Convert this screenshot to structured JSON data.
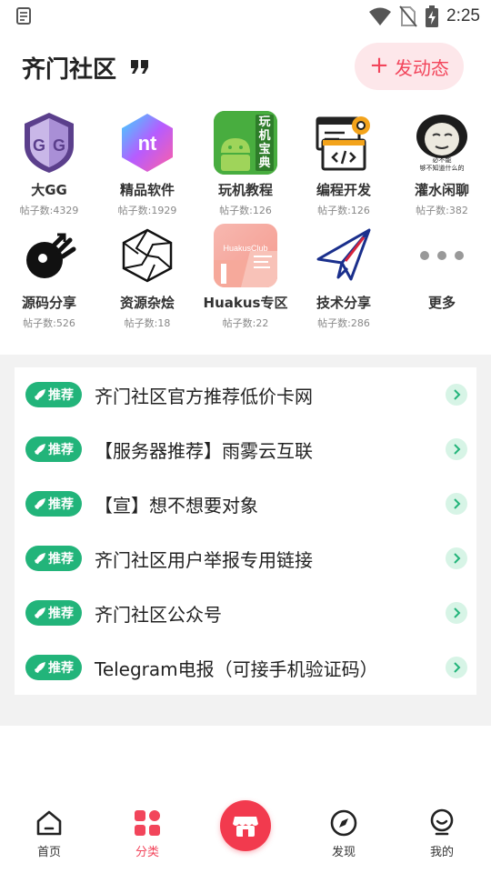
{
  "status_bar": {
    "time": "2:25",
    "icons": [
      "notes-icon",
      "wifi-icon",
      "no-sim-icon",
      "battery-charging-icon"
    ]
  },
  "header": {
    "title": "齐门社区",
    "post_button_label": "发动态",
    "accent_color": "#f2455b"
  },
  "categories": [
    {
      "label": "大GG",
      "count": "帖子数:4329",
      "icon": "gg-shield-icon"
    },
    {
      "label": "精品软件",
      "count": "帖子数:1929",
      "icon": "nt-hexagon-icon"
    },
    {
      "label": "玩机教程",
      "count": "帖子数:126",
      "icon": "android-icon",
      "icon_text": [
        "玩",
        "机",
        "宝",
        "典"
      ]
    },
    {
      "label": "编程开发",
      "count": "帖子数:126",
      "icon": "code-window-icon"
    },
    {
      "label": "灌水闲聊",
      "count": "帖子数:382",
      "icon": "meme-face-icon",
      "icon_text": [
        "必不能",
        "够不知道什么的"
      ]
    },
    {
      "label": "源码分享",
      "count": "帖子数:526",
      "icon": "source-share-icon"
    },
    {
      "label": "资源杂烩",
      "count": "帖子数:18",
      "icon": "hexagon-cube-icon"
    },
    {
      "label": "Huakus专区",
      "count": "帖子数:22",
      "icon": "huakus-club-icon",
      "icon_text": "HuakusClub"
    },
    {
      "label": "技术分享",
      "count": "帖子数:286",
      "icon": "paper-plane-icon"
    },
    {
      "label": "更多",
      "count": "",
      "icon": "more-dots-icon"
    }
  ],
  "recommend": {
    "badge_label": "推荐",
    "badge_color": "#22b47a",
    "items": [
      {
        "title": "齐门社区官方推荐低价卡网"
      },
      {
        "title": "【服务器推荐】雨雾云互联"
      },
      {
        "title": "【宣】想不想要对象"
      },
      {
        "title": "齐门社区用户举报专用链接"
      },
      {
        "title": "齐门社区公众号"
      },
      {
        "title": "Telegram电报（可接手机验证码）"
      }
    ]
  },
  "bottom_nav": {
    "items": [
      {
        "label": "首页",
        "icon": "home-icon",
        "active": false
      },
      {
        "label": "分类",
        "icon": "category-grid-icon",
        "active": true
      },
      {
        "label": "",
        "icon": "store-icon",
        "active": false
      },
      {
        "label": "发现",
        "icon": "compass-icon",
        "active": false
      },
      {
        "label": "我的",
        "icon": "profile-icon",
        "active": false
      }
    ]
  }
}
